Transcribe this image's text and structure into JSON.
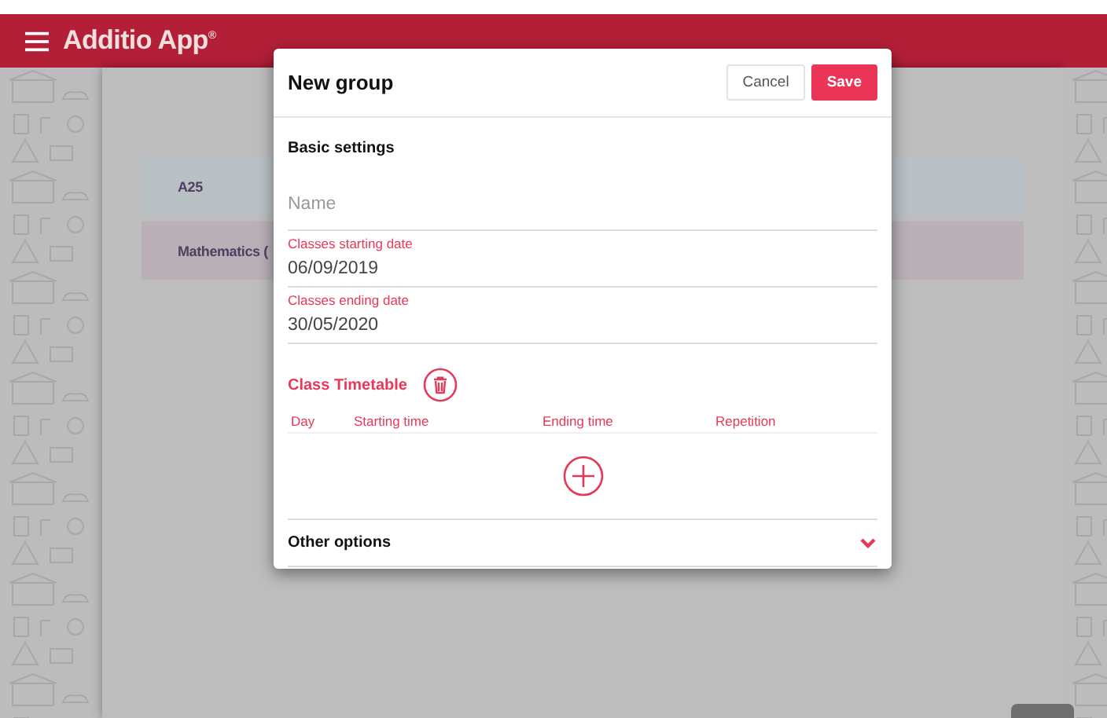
{
  "header": {
    "title": "Additio App$^{®}$"
  },
  "groups": [
    {
      "name": "A25",
      "color": "#b9c0c4"
    },
    {
      "name": "Mathematics (",
      "color": "#b8afb7"
    }
  ],
  "dialog": {
    "title": "New group",
    "buttons": [
      {
        "label": "Cancel",
        "kind": "secondary"
      },
      {
        "label": "Save",
        "kind": "primary"
      }
    ],
    "section": "Basic settings",
    "fields": [
      {
        "placeholder": "Name"
      },
      {
        "label": "Classes starting date",
        "value": "06/09/2019"
      },
      {
        "label": "Classes ending date",
        "value": "30/05/2020"
      }
    ],
    "timetable": {
      "title": "Class Timetable",
      "columns": [
        "Day",
        "Starting time",
        "Ending time",
        "Repetition"
      ]
    },
    "other_options": {
      "label": "Other options",
      "expanded": false
    }
  }
}
